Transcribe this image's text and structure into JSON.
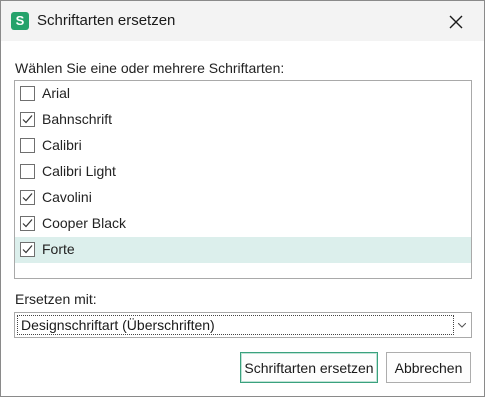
{
  "window": {
    "title": "Schriftarten ersetzen",
    "app_icon_letter": "S",
    "accent_color": "#25a26b"
  },
  "dialog": {
    "prompt": "Wählen Sie eine oder mehrere Schriftarten:",
    "fonts": [
      {
        "label": "Arial",
        "checked": false,
        "selected": false
      },
      {
        "label": "Bahnschrift",
        "checked": true,
        "selected": false
      },
      {
        "label": "Calibri",
        "checked": false,
        "selected": false
      },
      {
        "label": "Calibri Light",
        "checked": false,
        "selected": false
      },
      {
        "label": "Cavolini",
        "checked": true,
        "selected": false
      },
      {
        "label": "Cooper Black",
        "checked": true,
        "selected": false
      },
      {
        "label": "Forte",
        "checked": true,
        "selected": true
      }
    ],
    "replace_label": "Ersetzen mit:",
    "replace_value": "Designschriftart (Überschriften)"
  },
  "buttons": {
    "replace": "Schriftarten ersetzen",
    "cancel": "Abbrechen"
  },
  "icons": {
    "close": "close-icon",
    "checkmark": "checkmark-icon",
    "dropdown": "chevron-down-icon"
  }
}
